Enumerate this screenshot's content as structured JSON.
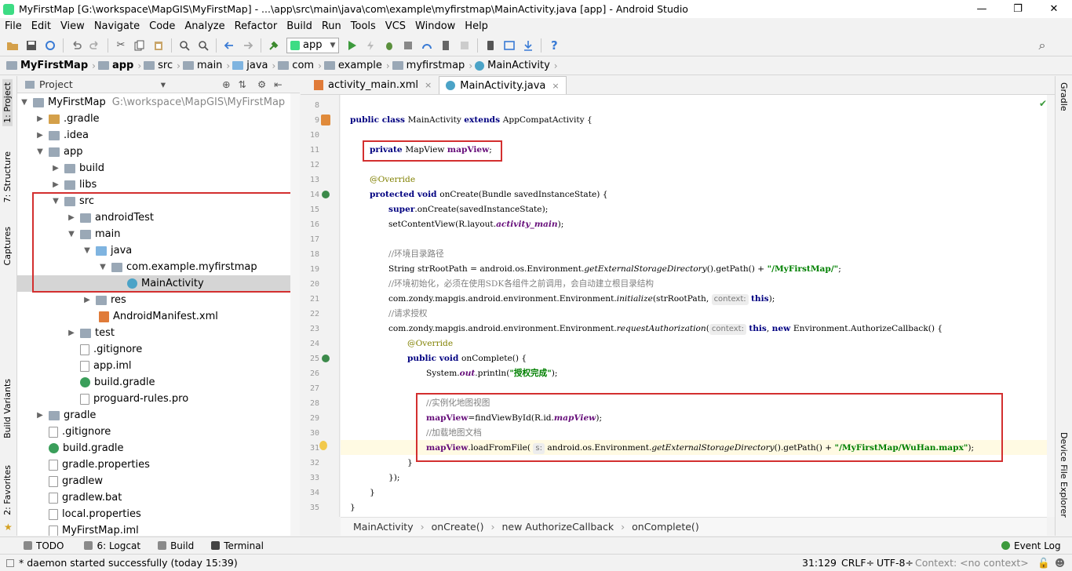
{
  "window": {
    "title": "MyFirstMap [G:\\workspace\\MapGIS\\MyFirstMap] - ...\\app\\src\\main\\java\\com\\example\\myfirstmap\\MainActivity.java [app] - Android Studio",
    "minimize": "—",
    "maximize": "❐",
    "close": "✕"
  },
  "menu": [
    "File",
    "Edit",
    "View",
    "Navigate",
    "Code",
    "Analyze",
    "Refactor",
    "Build",
    "Run",
    "Tools",
    "VCS",
    "Window",
    "Help"
  ],
  "toolbar": {
    "config": "app",
    "config_arrow": "▼",
    "help": "?",
    "search": "⌕"
  },
  "nav_crumbs": [
    "MyFirstMap",
    "app",
    "src",
    "main",
    "java",
    "com",
    "example",
    "myfirstmap",
    "MainActivity"
  ],
  "left_tabs": {
    "project": "1: Project",
    "structure": "7: Structure",
    "captures": "Captures",
    "build_variants": "Build Variants",
    "favorites": "2: Favorites"
  },
  "right_tabs": {
    "gradle": "Gradle",
    "device_explorer": "Device File Explorer"
  },
  "project_panel": {
    "label": "Project",
    "dropdown": "▾"
  },
  "tree": [
    {
      "text": "MyFirstMap",
      "extra": "G:\\workspace\\MapGIS\\MyFirstMap"
    },
    {
      "text": ".gradle"
    },
    {
      "text": ".idea"
    },
    {
      "text": "app"
    },
    {
      "text": "build"
    },
    {
      "text": "libs"
    },
    {
      "text": "src"
    },
    {
      "text": "androidTest"
    },
    {
      "text": "main"
    },
    {
      "text": "java"
    },
    {
      "text": "com.example.myfirstmap"
    },
    {
      "text": "MainActivity"
    },
    {
      "text": "res"
    },
    {
      "text": "AndroidManifest.xml"
    },
    {
      "text": "test"
    },
    {
      "text": ".gitignore"
    },
    {
      "text": "app.iml"
    },
    {
      "text": "build.gradle"
    },
    {
      "text": "proguard-rules.pro"
    },
    {
      "text": "gradle"
    },
    {
      "text": ".gitignore"
    },
    {
      "text": "build.gradle"
    },
    {
      "text": "gradle.properties"
    },
    {
      "text": "gradlew"
    },
    {
      "text": "gradlew.bat"
    },
    {
      "text": "local.properties"
    },
    {
      "text": "MyFirstMap.iml"
    }
  ],
  "editor_tabs": [
    {
      "label": "activity_main.xml",
      "close": "×"
    },
    {
      "label": "MainActivity.java",
      "close": "×"
    }
  ],
  "line_numbers": [
    "8",
    "9",
    "10",
    "11",
    "12",
    "13",
    "14",
    "15",
    "16",
    "17",
    "18",
    "19",
    "20",
    "21",
    "22",
    "23",
    "24",
    "25",
    "26",
    "27",
    "28",
    "29",
    "30",
    "31",
    "32",
    "33",
    "34",
    "35"
  ],
  "code": {
    "l9": [
      "public class ",
      "MainActivity ",
      "extends ",
      "AppCompatActivity {"
    ],
    "l11": [
      "private ",
      "MapView ",
      "mapView",
      ";"
    ],
    "l13": "@Override",
    "l14": [
      "protected void ",
      "onCreate(Bundle savedInstanceState) {"
    ],
    "l15": [
      "super",
      ".onCreate(savedInstanceState);"
    ],
    "l16": [
      "setContentView(R.layout.",
      "activity_main",
      ");"
    ],
    "l18": "//环境目录路径",
    "l19": [
      "String strRootPath = android.os.Environment.",
      "getExternalStorageDirectory",
      "().getPath() + ",
      "\"/MyFirstMap/\"",
      ";"
    ],
    "l20": "//环境初始化，必须在使用SDK各组件之前调用，会自动建立根目录结构",
    "l21": [
      "com.zondy.mapgis.android.environment.Environment.",
      "initialize",
      "(strRootPath, ",
      "context:",
      "this",
      ");"
    ],
    "l22": "//请求授权",
    "l23": [
      "com.zondy.mapgis.android.environment.Environment.",
      "requestAuthorization",
      "(",
      "context:",
      "this",
      ", ",
      "new ",
      "Environment.AuthorizeCallback() {"
    ],
    "l24": "@Override",
    "l25": [
      "public void ",
      "onComplete() {"
    ],
    "l26": [
      "System.",
      "out",
      ".println(",
      "\"授权完成\"",
      ");"
    ],
    "l28": "//实例化地图视图",
    "l29": [
      "mapView",
      "=findViewById(R.id.",
      "mapView",
      ");"
    ],
    "l30": "//加载地图文档",
    "l31": [
      "mapView",
      ".loadFromFile( ",
      "s:",
      " android.os.Environment.",
      "getExternalStorageDirectory",
      "().getPath() + ",
      "\"/MyFirstMap/WuHan.mapx\"",
      ");"
    ],
    "l32": "}",
    "l33": "});",
    "l34": "}",
    "l35": "}"
  },
  "editor_breadcrumb": [
    "MainActivity",
    "onCreate()",
    "new AuthorizeCallback",
    "onComplete()"
  ],
  "bottom_tools": [
    {
      "label": "TODO"
    },
    {
      "label": "6: Logcat"
    },
    {
      "label": "Build"
    },
    {
      "label": "Terminal"
    }
  ],
  "event_log": "Event Log",
  "status": {
    "message": "* daemon started successfully (today 15:39)",
    "position": "31:129",
    "line_sep": "CRLF÷",
    "encoding": "UTF-8÷",
    "context": "Context: <no context>"
  },
  "colors": {
    "keyword": "#000080",
    "field": "#660e7a",
    "string": "#008000",
    "comment": "#808080",
    "annotation": "#808000",
    "highlight_box": "#d32f2f"
  }
}
